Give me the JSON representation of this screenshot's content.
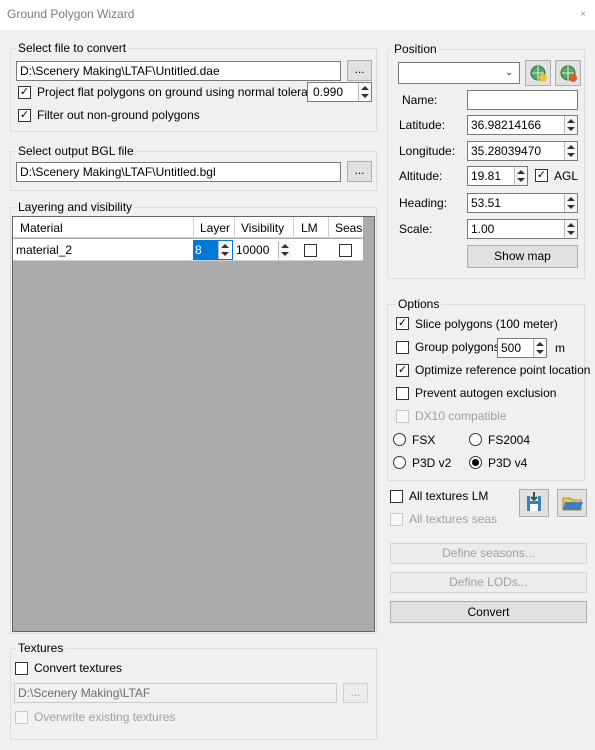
{
  "window": {
    "title": "Ground Polygon Wizard",
    "close_glyph": "×"
  },
  "convert_file": {
    "group_label": "Select file to convert",
    "path": "D:\\Scenery Making\\LTAF\\Untitled.dae",
    "browse_label": "...",
    "project_flat_label": "Project flat polygons on ground using normal tolerance:",
    "project_flat_checked": true,
    "tolerance": "0.990",
    "filter_label": "Filter out non-ground polygons",
    "filter_checked": true
  },
  "output_file": {
    "group_label": "Select output BGL file",
    "path": "D:\\Scenery Making\\LTAF\\Untitled.bgl",
    "browse_label": "..."
  },
  "layering": {
    "group_label": "Layering and visibility",
    "columns": [
      "Material",
      "Layer",
      "Visibility",
      "LM",
      "Seas"
    ],
    "rows": [
      {
        "material": "material_2",
        "layer": "8",
        "visibility": "10000",
        "lm": false,
        "seas": false
      }
    ]
  },
  "textures": {
    "group_label": "Textures",
    "convert_label": "Convert textures",
    "convert_checked": false,
    "path": "D:\\Scenery Making\\LTAF",
    "browse_label": "...",
    "overwrite_label": "Overwrite existing textures"
  },
  "position": {
    "group_label": "Position",
    "dropdown_value": "",
    "name_label": "Name:",
    "name_value": "",
    "latitude_label": "Latitude:",
    "latitude": "36.98214166",
    "longitude_label": "Longitude:",
    "longitude": "35.28039470",
    "altitude_label": "Altitude:",
    "altitude": "19.81",
    "agl_label": "AGL",
    "agl_checked": true,
    "heading_label": "Heading:",
    "heading": "53.51",
    "scale_label": "Scale:",
    "scale": "1.00",
    "show_map_label": "Show map"
  },
  "options": {
    "group_label": "Options",
    "slice_label": "Slice polygons (100 meter)",
    "slice_checked": true,
    "group_polygons_label": "Group polygons",
    "group_polygons_checked": false,
    "group_value": "500",
    "group_unit": "m",
    "optimize_label": "Optimize reference point location",
    "optimize_checked": true,
    "prevent_label": "Prevent autogen exclusion",
    "prevent_checked": false,
    "dx10_label": "DX10 compatible",
    "sims": {
      "fsx": "FSX",
      "fs2004": "FS2004",
      "p3dv2": "P3D v2",
      "p3dv4": "P3D v4",
      "selected": "P3D v4"
    }
  },
  "bottom": {
    "all_lm_label": "All textures LM",
    "all_lm_checked": false,
    "all_seas_label": "All textures seas",
    "define_seasons_label": "Define seasons...",
    "define_lods_label": "Define LODs...",
    "convert_label": "Convert"
  }
}
